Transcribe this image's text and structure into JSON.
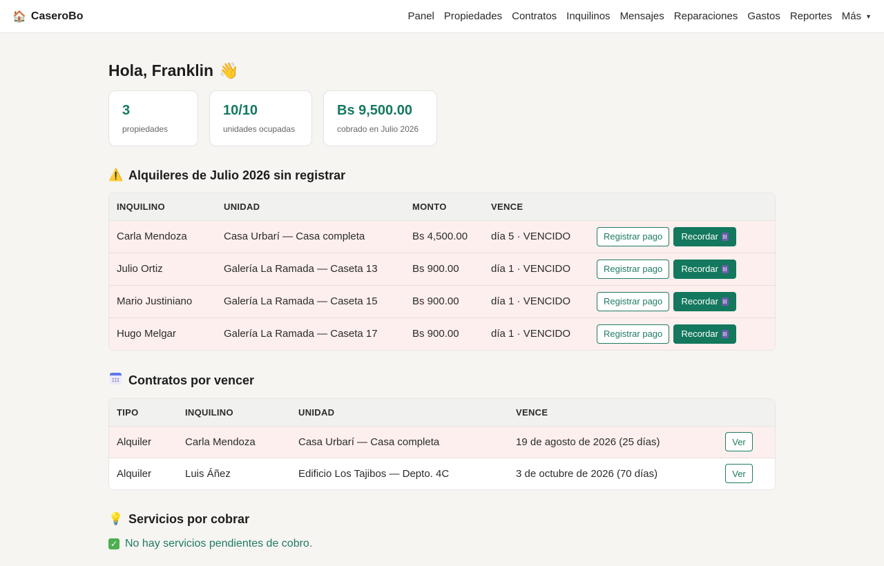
{
  "brand": {
    "icon": "🏠",
    "name": "CaseroBo"
  },
  "nav": {
    "items": [
      "Panel",
      "Propiedades",
      "Contratos",
      "Inquilinos",
      "Mensajes",
      "Reparaciones",
      "Gastos",
      "Reportes"
    ],
    "more_label": "Más"
  },
  "greeting": {
    "text": "Hola, Franklin",
    "emoji": "👋"
  },
  "stats": [
    {
      "value": "3",
      "label": "propiedades"
    },
    {
      "value": "10/10",
      "label": "unidades ocupadas"
    },
    {
      "value": "Bs 9,500.00",
      "label": "cobrado en Julio 2026"
    }
  ],
  "unregistered": {
    "icon": "⚠️",
    "title": "Alquileres de Julio 2026 sin registrar",
    "headers": [
      "INQUILINO",
      "UNIDAD",
      "MONTO",
      "VENCE"
    ],
    "register_label": "Registrar pago",
    "remind_label": "Recordar",
    "rows": [
      {
        "tenant": "Carla Mendoza",
        "unit": "Casa Urbarí — Casa completa",
        "amount": "Bs 4,500.00",
        "due": "día 5 · VENCIDO"
      },
      {
        "tenant": "Julio Ortiz",
        "unit": "Galería La Ramada — Caseta 13",
        "amount": "Bs 900.00",
        "due": "día 1 · VENCIDO"
      },
      {
        "tenant": "Mario Justiniano",
        "unit": "Galería La Ramada — Caseta 15",
        "amount": "Bs 900.00",
        "due": "día 1 · VENCIDO"
      },
      {
        "tenant": "Hugo Melgar",
        "unit": "Galería La Ramada — Caseta 17",
        "amount": "Bs 900.00",
        "due": "día 1 · VENCIDO"
      }
    ]
  },
  "contracts": {
    "title": "Contratos por vencer",
    "headers": [
      "TIPO",
      "INQUILINO",
      "UNIDAD",
      "VENCE"
    ],
    "view_label": "Ver",
    "rows": [
      {
        "type": "Alquiler",
        "tenant": "Carla Mendoza",
        "unit": "Casa Urbarí — Casa completa",
        "due": "19 de agosto de 2026 (25 días)",
        "highlight": true
      },
      {
        "type": "Alquiler",
        "tenant": "Luis Áñez",
        "unit": "Edificio Los Tajibos — Depto. 4C",
        "due": "3 de octubre de 2026 (70 días)",
        "highlight": false
      }
    ]
  },
  "services": {
    "icon": "💡",
    "title": "Servicios por cobrar",
    "empty_message": "No hay servicios pendientes de cobro."
  }
}
